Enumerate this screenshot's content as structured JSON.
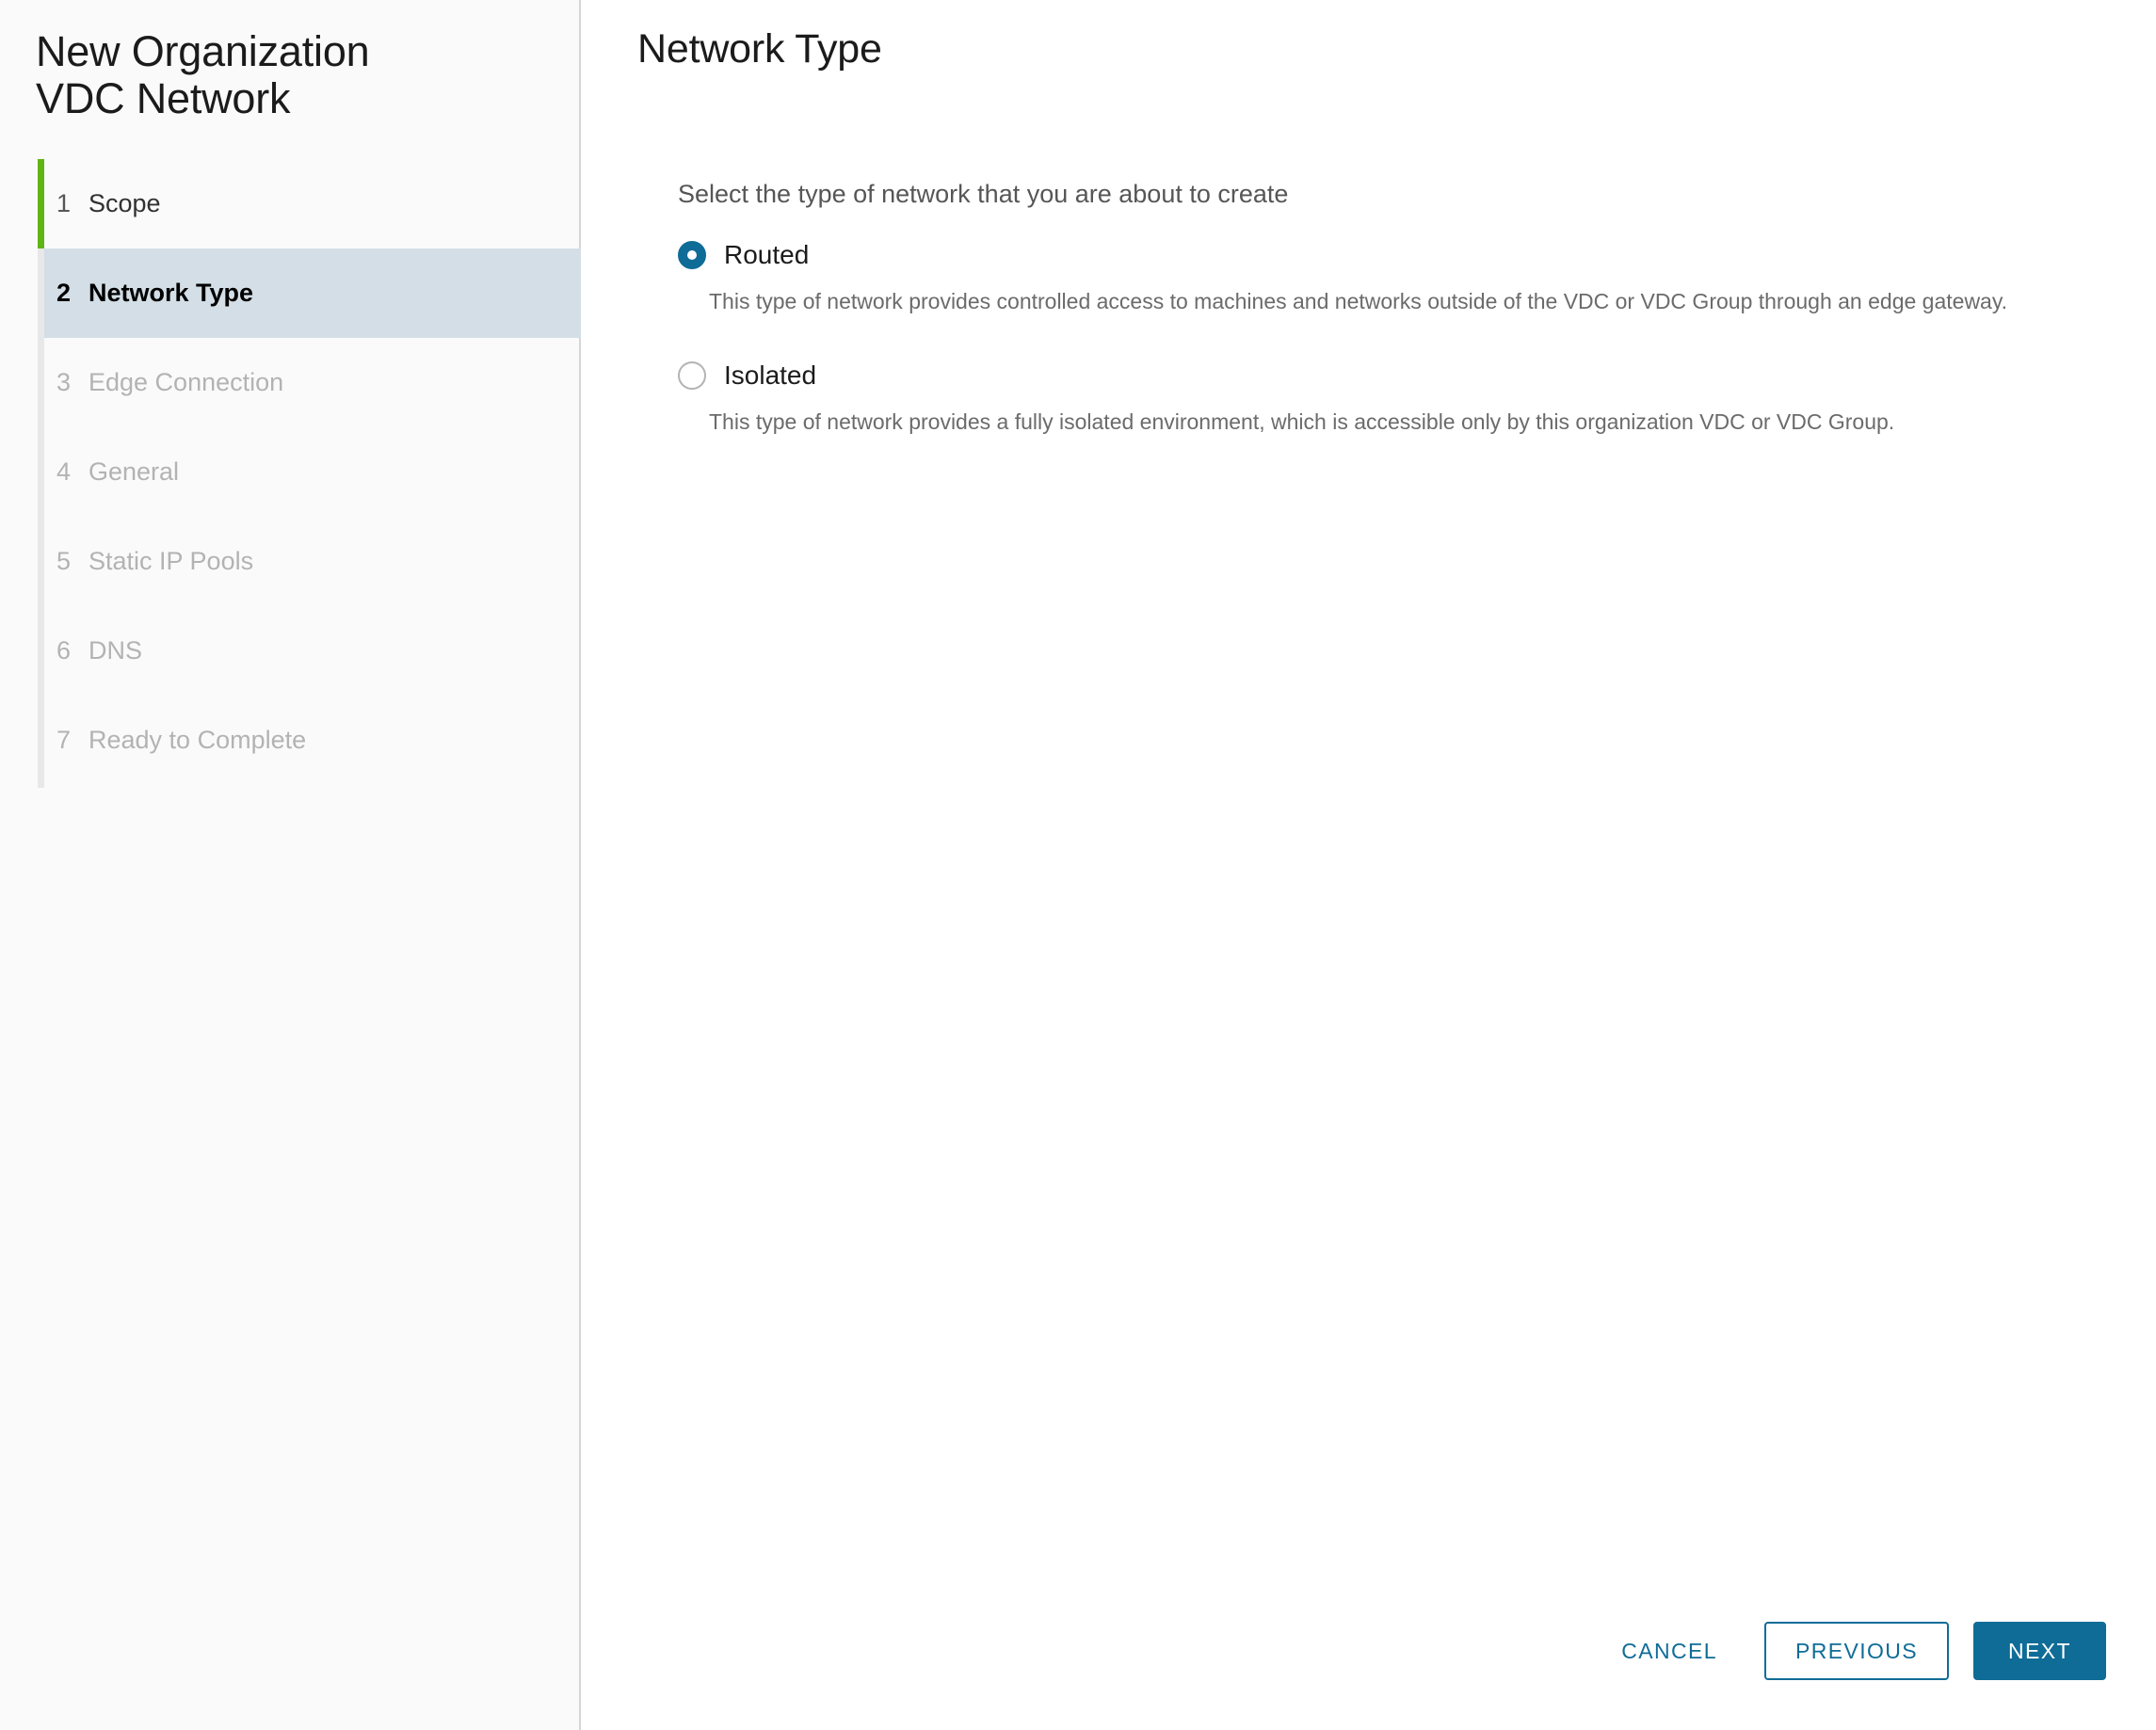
{
  "wizard": {
    "title": "New Organization VDC Network",
    "accent_green": "#60b515",
    "accent_blue": "#0f6c97",
    "active_step_bg": "#d3dee6"
  },
  "sidebar": {
    "steps": [
      {
        "number": "1",
        "label": "Scope",
        "state": "done"
      },
      {
        "number": "2",
        "label": "Network Type",
        "state": "active"
      },
      {
        "number": "3",
        "label": "Edge Connection",
        "state": "upcoming"
      },
      {
        "number": "4",
        "label": "General",
        "state": "upcoming"
      },
      {
        "number": "5",
        "label": "Static IP Pools",
        "state": "upcoming"
      },
      {
        "number": "6",
        "label": "DNS",
        "state": "upcoming"
      },
      {
        "number": "7",
        "label": "Ready to Complete",
        "state": "upcoming"
      }
    ]
  },
  "main": {
    "title": "Network Type",
    "instruction": "Select the type of network that you are about to create",
    "options": [
      {
        "label": "Routed",
        "selected": true,
        "description": "This type of network provides controlled access to machines and networks outside of the VDC or VDC Group through an edge gateway."
      },
      {
        "label": "Isolated",
        "selected": false,
        "description": "This type of network provides a fully isolated environment, which is accessible only by this organization VDC or VDC Group."
      }
    ]
  },
  "footer": {
    "cancel_label": "CANCEL",
    "previous_label": "PREVIOUS",
    "next_label": "NEXT"
  }
}
